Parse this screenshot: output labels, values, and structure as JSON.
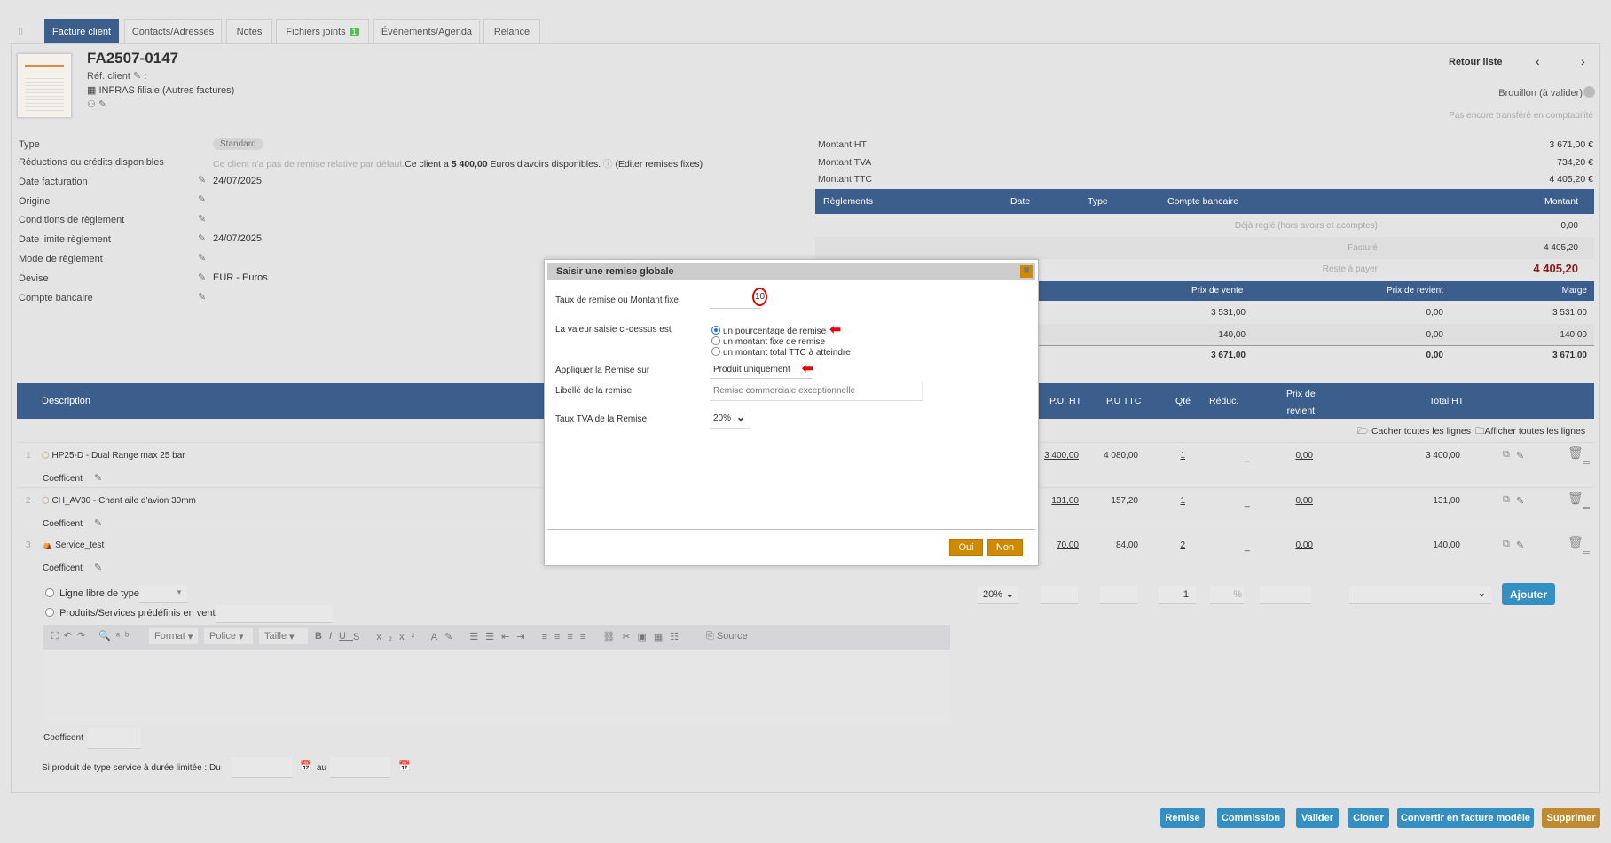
{
  "tabs": [
    {
      "label": "Facture client"
    },
    {
      "label": "Contacts/Adresses"
    },
    {
      "label": "Notes"
    },
    {
      "label": "Fichiers joints",
      "badge": "1"
    },
    {
      "label": "Événements/Agenda"
    },
    {
      "label": "Relance"
    }
  ],
  "header": {
    "ref": "FA2507-0147",
    "ref_client_label": "Réf. client",
    "ref_client_sep": ":",
    "thirdparty": "INFRAS filiale (Autres factures)",
    "back_list": "Retour liste",
    "status": "Brouillon (à valider)",
    "accounting": "Pas encore transféré en comptabilité"
  },
  "fields": [
    {
      "label": "Type",
      "value": "Standard"
    },
    {
      "label": "Réductions ou crédits disponibles",
      "value_muted": "Ce client n'a pas de remise relative par défaut.",
      "value_pre": "Ce client a ",
      "value_bold": "5 400,00",
      "value_post": " Euros d'avoirs disponibles.",
      "link": "(Editer remises fixes)"
    },
    {
      "label": "Date facturation",
      "value": "24/07/2025"
    },
    {
      "label": "Origine",
      "value": ""
    },
    {
      "label": "Conditions de règlement",
      "value": ""
    },
    {
      "label": "Date limite règlement",
      "value": "24/07/2025"
    },
    {
      "label": "Mode de règlement",
      "value": ""
    },
    {
      "label": "Devise",
      "value": "EUR - Euros"
    },
    {
      "label": "Compte bancaire",
      "value": ""
    }
  ],
  "amounts": [
    {
      "label": "Montant HT",
      "value": "3 671,00 €"
    },
    {
      "label": "Montant TVA",
      "value": "734,20 €"
    },
    {
      "label": "Montant TTC",
      "value": "4 405,20 €"
    }
  ],
  "payments": {
    "headers": [
      "Règlements",
      "Date",
      "Type",
      "Compte bancaire",
      "Montant"
    ],
    "rows": [
      {
        "label": "Déjà réglé (hors avoirs et acomptes)",
        "value": "0,00"
      },
      {
        "label": "Facturé",
        "value": "4 405,20"
      },
      {
        "label": "Reste à payer",
        "value": "4 405,20"
      }
    ]
  },
  "margins": {
    "headers": [
      "Prix de vente",
      "Prix de revient",
      "Marge"
    ],
    "rows": [
      [
        "3 531,00",
        "0,00",
        "3 531,00"
      ],
      [
        "140,00",
        "0,00",
        "140,00"
      ]
    ],
    "total": [
      "3 671,00",
      "0,00",
      "3 671,00"
    ]
  },
  "lines": {
    "headers": {
      "description": "Description",
      "pu_ht": "P.U. HT",
      "pu_ttc": "P.U TTC",
      "qty": "Qté",
      "reduc": "Réduc.",
      "cost1": "Prix de",
      "cost2": "revient",
      "total": "Total HT"
    },
    "hide_all": "Cacher toutes les lignes",
    "show_all": "Afficher toutes les lignes",
    "coef_label": "Coefficent",
    "rows": [
      {
        "num": "1",
        "desc": "HP25-D - Dual Range max 25 bar",
        "pu_ht": "3 400,00",
        "pu_ttc": "4 080,00",
        "qty": "1",
        "reduc": "_",
        "cost": "0,00",
        "total": "3 400,00"
      },
      {
        "num": "2",
        "desc": "CH_AV30 - Chant aile d'avion 30mm",
        "pu_ht": "131,00",
        "pu_ttc": "157,20",
        "qty": "1",
        "reduc": "_",
        "cost": "0,00",
        "total": "131,00"
      },
      {
        "num": "3",
        "desc": "Service_test",
        "pu_ht": "70,00",
        "pu_ttc": "84,00",
        "qty": "2",
        "reduc": "_",
        "cost": "0,00",
        "total": "140,00"
      }
    ]
  },
  "addline": {
    "free_line": "Ligne libre de type",
    "predefined": "Produits/Services prédéfinis en vente",
    "vat": "20%",
    "qty": "1",
    "pct": "%",
    "add": "Ajouter",
    "toolbar": {
      "format": "Format",
      "font": "Police",
      "size": "Taille",
      "source": "Source"
    },
    "coef": "Coefficent",
    "service_label": "Si produit de type service à durée limitée : Du",
    "to": "au"
  },
  "actions": [
    "Remise",
    "Commission",
    "Valider",
    "Cloner",
    "Convertir en facture modèle",
    "Supprimer"
  ],
  "modal": {
    "title": "Saisir une remise globale",
    "rate_label": "Taux de remise ou Montant fixe",
    "rate_value": "10",
    "type_label": "La valeur saisie ci-dessus est",
    "options": [
      "un pourcentage de remise",
      "un montant fixe de remise",
      "un montant total TTC à atteindre"
    ],
    "apply_label": "Appliquer la Remise sur",
    "apply_value": "Produit uniquement",
    "libelle_label": "Libellé de la remise",
    "libelle_placeholder": "Remise commerciale exceptionnelle",
    "vat_label": "Taux TVA de la Remise",
    "vat_value": "20%",
    "yes": "Oui",
    "no": "Non"
  },
  "colors": {
    "header_blue": "#3b5e8c",
    "button_blue": "#3490c2",
    "delete": "#c08a30",
    "modal_button": "#d08a00",
    "due": "#8b1a1a",
    "annotation": "#e00000"
  }
}
